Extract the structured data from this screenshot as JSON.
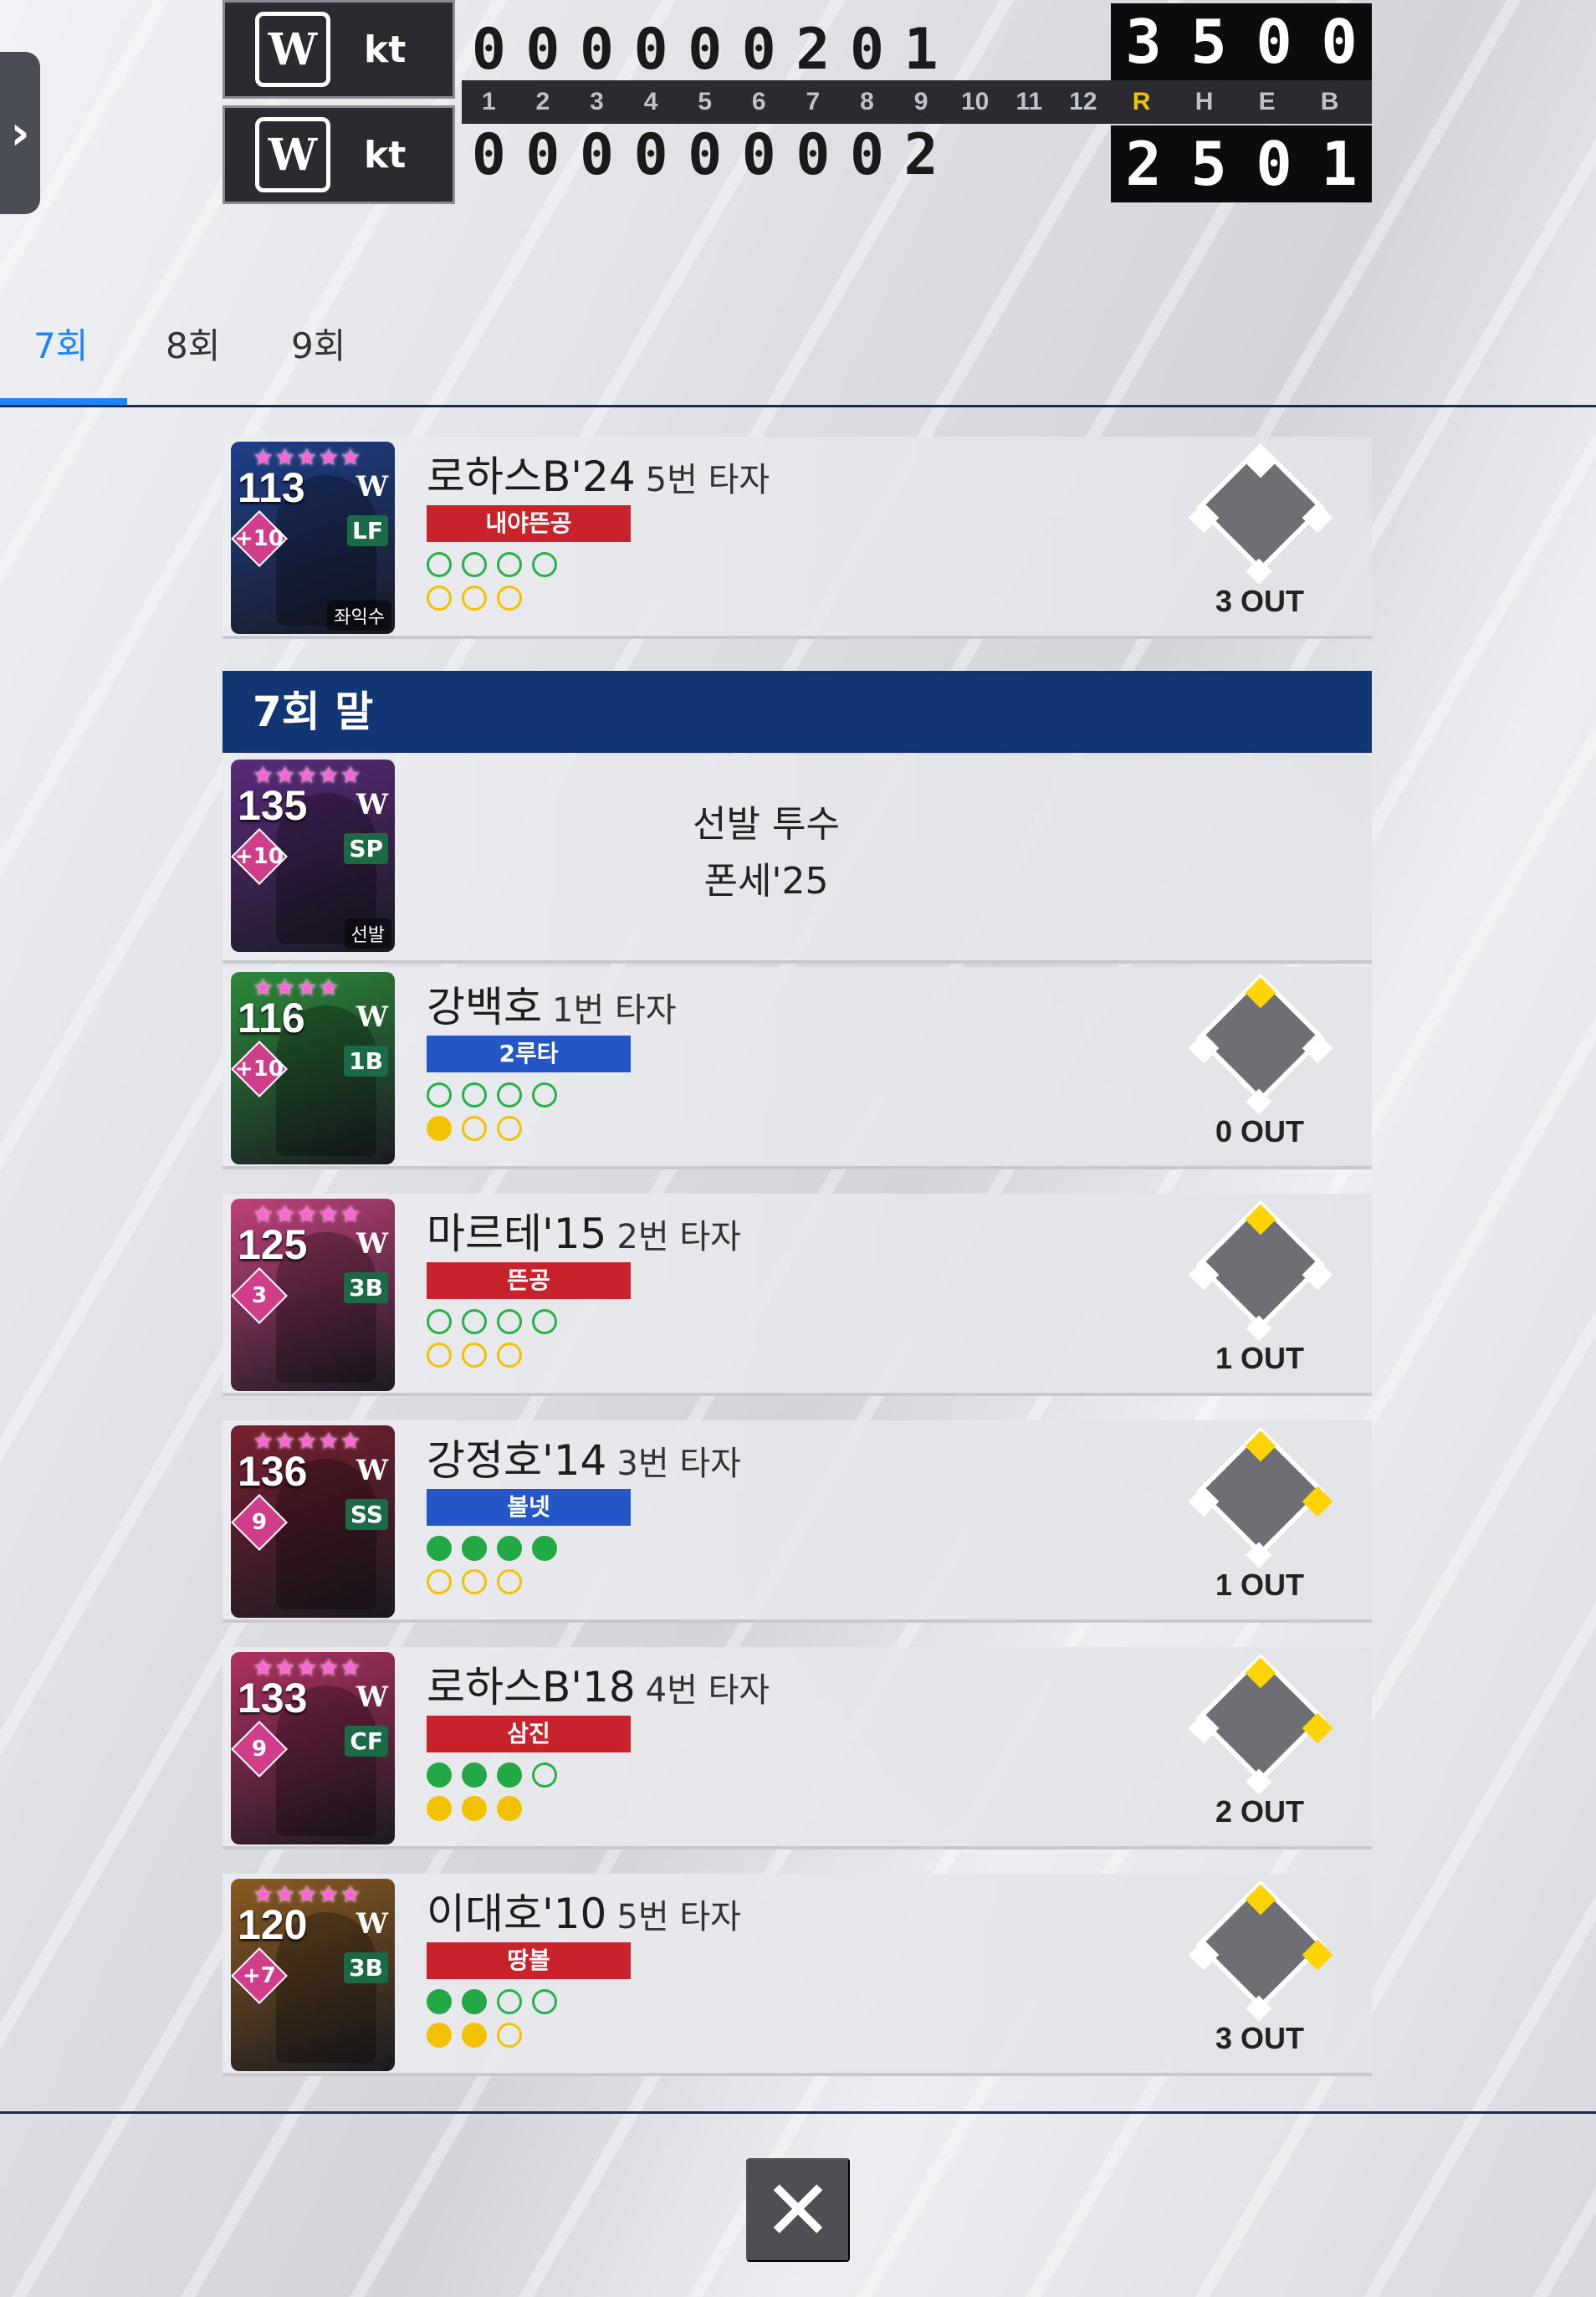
{
  "scoreboard": {
    "away": {
      "team": "kt",
      "logo": "W",
      "innings": [
        "0",
        "0",
        "0",
        "0",
        "0",
        "0",
        "2",
        "0",
        "1"
      ],
      "R": "3",
      "H": "5",
      "E": "0",
      "B": "0"
    },
    "home": {
      "team": "kt",
      "logo": "W",
      "innings": [
        "0",
        "0",
        "0",
        "0",
        "0",
        "0",
        "0",
        "0",
        "2"
      ],
      "R": "2",
      "H": "5",
      "E": "0",
      "B": "1"
    },
    "inning_labels": [
      "1",
      "2",
      "3",
      "4",
      "5",
      "6",
      "7",
      "8",
      "9",
      "10",
      "11",
      "12"
    ],
    "total_labels": [
      "R",
      "H",
      "E",
      "B"
    ]
  },
  "tabs": [
    {
      "label": "7회"
    },
    {
      "label": "8회"
    },
    {
      "label": "9회"
    }
  ],
  "section_header": "7회 말",
  "top_row": {
    "name": "로하스B'24",
    "order": "5번 타자",
    "result": "내야뜬공",
    "result_color": "red",
    "balls_on": 0,
    "balls_total": 4,
    "strikes_on": 0,
    "strikes_total": 3,
    "bases": {
      "first": false,
      "second": false,
      "third": false
    },
    "outs": "3 OUT",
    "card": {
      "ovr": "113",
      "plus": "+10",
      "pos": "LF",
      "stars": "★★★★★",
      "badge": "좌익수",
      "color": "#1e3f8a"
    }
  },
  "pitcher": {
    "label": "선발 투수",
    "name": "폰세'25",
    "card": {
      "ovr": "135",
      "plus": "+10",
      "pos": "SP",
      "stars": "★★★★★",
      "badge": "선발",
      "color": "#5a2a7a"
    }
  },
  "batters": [
    {
      "name": "강백호",
      "order": "1번 타자",
      "result": "2루타",
      "result_color": "blue",
      "balls_on": 0,
      "strikes_on": 1,
      "bases": {
        "first": false,
        "second": true,
        "third": false
      },
      "outs": "0 OUT",
      "card": {
        "ovr": "116",
        "plus": "+10",
        "pos": "1B",
        "stars": "★★★★",
        "color": "#2d8a3a"
      }
    },
    {
      "name": "마르테'15",
      "order": "2번 타자",
      "result": "뜬공",
      "result_color": "red",
      "balls_on": 0,
      "strikes_on": 0,
      "bases": {
        "first": false,
        "second": true,
        "third": false
      },
      "outs": "1 OUT",
      "card": {
        "ovr": "125",
        "plus": "3",
        "pos": "3B",
        "stars": "★★★★★",
        "color": "#c0407a"
      }
    },
    {
      "name": "강정호'14",
      "order": "3번 타자",
      "result": "볼넷",
      "result_color": "blue",
      "balls_on": 4,
      "strikes_on": 0,
      "bases": {
        "first": true,
        "second": true,
        "third": false
      },
      "outs": "1 OUT",
      "card": {
        "ovr": "136",
        "plus": "9",
        "pos": "SS",
        "stars": "★★★★★",
        "color": "#7a2030"
      }
    },
    {
      "name": "로하스B'18",
      "order": "4번 타자",
      "result": "삼진",
      "result_color": "red",
      "balls_on": 3,
      "strikes_on": 3,
      "bases": {
        "first": true,
        "second": true,
        "third": false
      },
      "outs": "2 OUT",
      "card": {
        "ovr": "133",
        "plus": "9",
        "pos": "CF",
        "stars": "★★★★★",
        "color": "#b03060"
      }
    },
    {
      "name": "이대호'10",
      "order": "5번 타자",
      "result": "땅볼",
      "result_color": "red",
      "balls_on": 2,
      "strikes_on": 2,
      "bases": {
        "first": true,
        "second": true,
        "third": false
      },
      "outs": "3 OUT",
      "card": {
        "ovr": "120",
        "plus": "+7",
        "pos": "3B",
        "stars": "★★★★★",
        "color": "#8a5a20"
      }
    }
  ],
  "icons": {
    "side_handle": "chevron-right-icon",
    "close": "close-icon"
  },
  "close_label": "✕",
  "handle_label": "›"
}
